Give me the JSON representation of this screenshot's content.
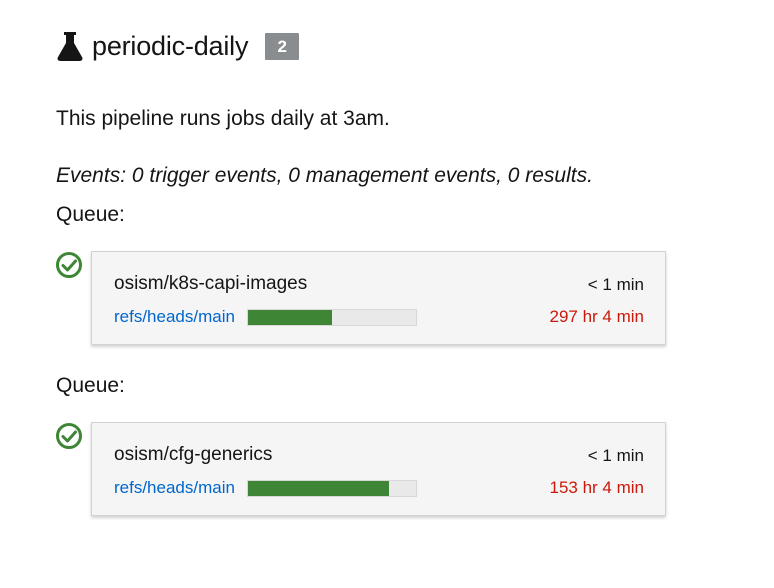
{
  "pipeline": {
    "icon": "flask-icon",
    "name": "periodic-daily",
    "badge": "2",
    "description": "This pipeline runs jobs daily at 3am.",
    "events": "Events: 0 trigger events, 0 management events, 0 results."
  },
  "queues": [
    {
      "label": "Queue:",
      "status_icon": "check-circle-icon",
      "item": {
        "project": "osism/k8s-capi-images",
        "ref": "refs/heads/main",
        "elapsed": "< 1 min",
        "remaining": "297 hr 4 min",
        "progress_percent": 50
      }
    },
    {
      "label": "Queue:",
      "status_icon": "check-circle-icon",
      "item": {
        "project": "osism/cfg-generics",
        "ref": "refs/heads/main",
        "elapsed": "< 1 min",
        "remaining": "153 hr 4 min",
        "progress_percent": 84
      }
    }
  ],
  "colors": {
    "success": "#3e8635",
    "danger": "#c9190b",
    "link": "#0066cc",
    "badge": "#8a8d90"
  }
}
